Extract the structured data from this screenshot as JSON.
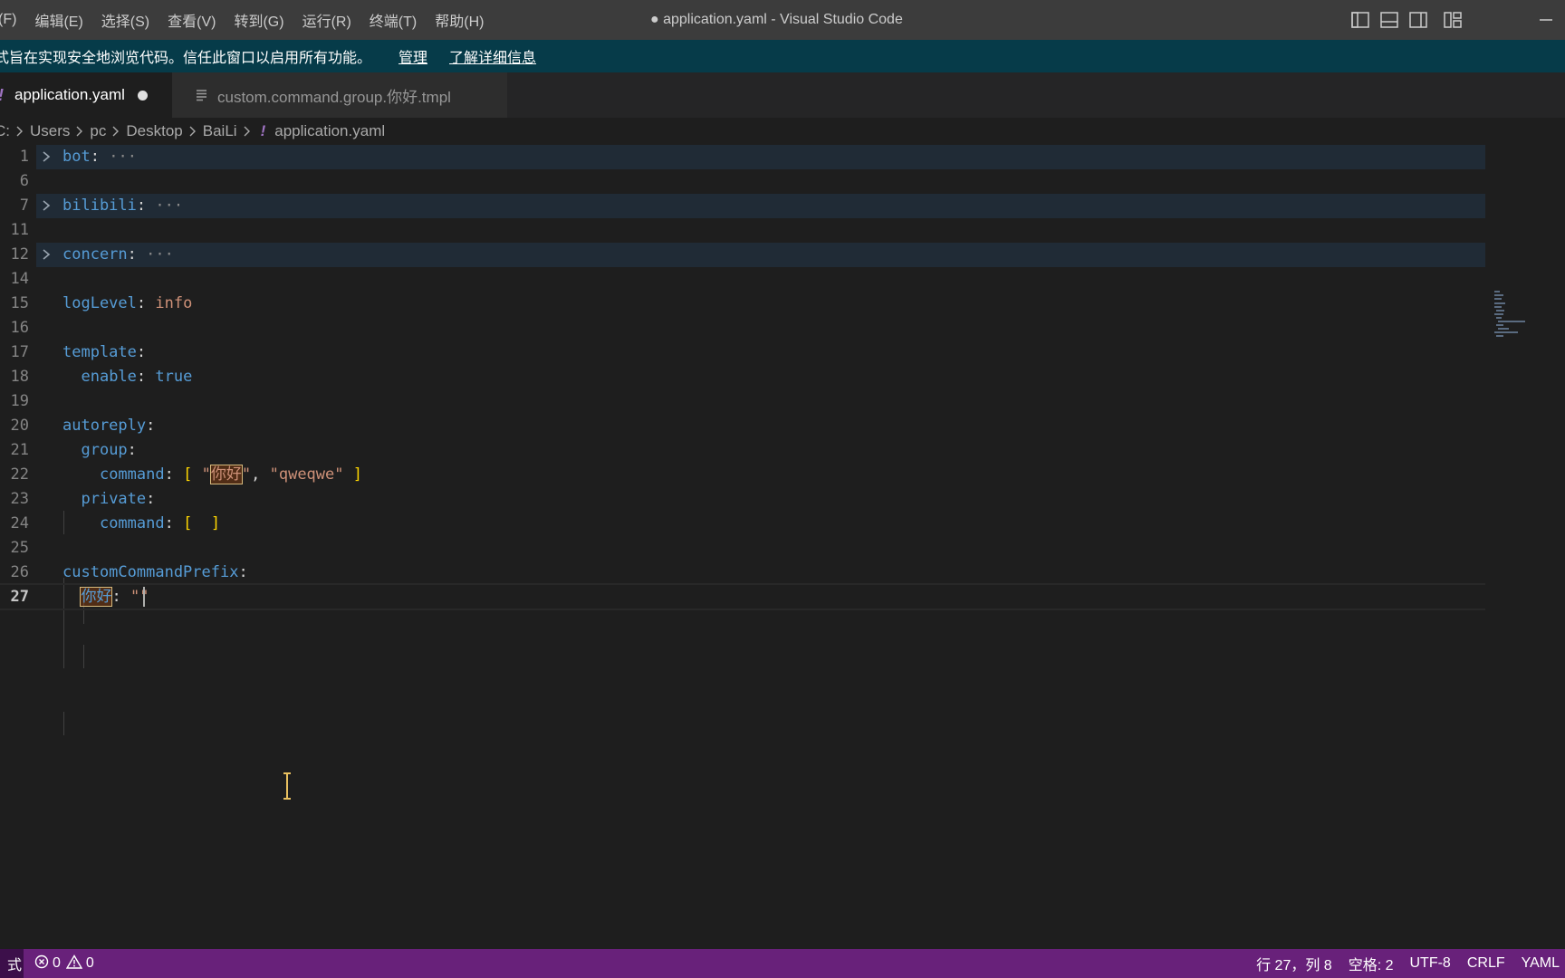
{
  "menu": {
    "items": [
      "(F)",
      "编辑(E)",
      "选择(S)",
      "查看(V)",
      "转到(G)",
      "运行(R)",
      "终端(T)",
      "帮助(H)"
    ]
  },
  "window": {
    "title": "● application.yaml - Visual Studio Code"
  },
  "banner": {
    "text": "式旨在实现安全地浏览代码。信任此窗口以启用所有功能。",
    "manage_label": "管理",
    "learn_more_label": "了解详细信息"
  },
  "tabs": [
    {
      "icon": "!",
      "label": "application.yaml",
      "dirty": true,
      "active": true
    },
    {
      "label": "custom.command.group.你好.tmpl",
      "active": false
    }
  ],
  "breadcrumb": {
    "segments": [
      "C:",
      "Users",
      "pc",
      "Desktop",
      "BaiLi"
    ],
    "file_icon": "!",
    "file": "application.yaml"
  },
  "editor": {
    "line_numbers": [
      "1",
      "6",
      "7",
      "11",
      "12",
      "14",
      "15",
      "16",
      "17",
      "18",
      "19",
      "20",
      "21",
      "22",
      "23",
      "24",
      "25",
      "26",
      "27"
    ],
    "folded_ellipsis": "···",
    "bot_key": "bot",
    "bilibili_key": "bilibili",
    "concern_key": "concern",
    "loglevel_key": "logLevel",
    "loglevel_val": "info",
    "template_key": "template",
    "enable_key": "enable",
    "enable_val": "true",
    "autoreply_key": "autoreply",
    "group_key": "group",
    "command_key": "command",
    "cmd_val_1": "你好",
    "cmd_val_2": "\"qweqwe\"",
    "private_key": "private",
    "prefix_key": "customCommandPrefix",
    "nihao_key": "你好",
    "colon": ":",
    "comma": ",",
    "quote": "\"",
    "open_br": "[",
    "close_br": "]",
    "current_line": "27"
  },
  "status": {
    "mode": "式",
    "errors": "0",
    "warnings": "0",
    "position": "行 27，列 8",
    "indent": "空格: 2",
    "encoding": "UTF-8",
    "eol": "CRLF",
    "language": "YAML"
  },
  "colors": {
    "statusbar": "#68217a",
    "banner": "#063b49",
    "keyword": "#569cd6",
    "string": "#ce9178",
    "bracket": "#ffd700"
  }
}
